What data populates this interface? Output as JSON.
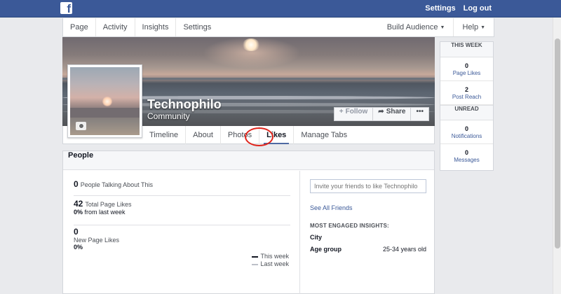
{
  "topbar": {
    "logo": "f",
    "links": [
      "Settings",
      "Log out"
    ]
  },
  "pagenav": {
    "left": [
      "Page",
      "Activity",
      "Insights",
      "Settings"
    ],
    "right": [
      "Build Audience",
      "Help"
    ]
  },
  "cover": {
    "title": "Technophilo",
    "subtitle": "Community",
    "buttons": {
      "follow": "Follow",
      "share": "Share",
      "more": "•••"
    }
  },
  "tabs": [
    "Timeline",
    "About",
    "Photos",
    "Likes",
    "Manage Tabs"
  ],
  "people": {
    "heading": "People",
    "talking": {
      "value": "0",
      "label": "People Talking About This"
    },
    "total_likes": {
      "value": "42",
      "label": "Total Page Likes",
      "change": "0%",
      "change_label": "from last week"
    },
    "new_likes": {
      "value": "0",
      "label": "New Page Likes",
      "change": "0%"
    },
    "legend": {
      "this_week": "This week",
      "last_week": "Last week"
    },
    "invite_placeholder": "Invite your friends to like Technophilo",
    "see_all": "See All Friends",
    "engaged_heading": "MOST ENGAGED INSIGHTS:",
    "city_label": "City",
    "age_label": "Age group",
    "age_value": "25-34 years old"
  },
  "sidebar": {
    "this_week": "THIS WEEK",
    "page_likes": {
      "value": "0",
      "label": "Page Likes"
    },
    "post_reach": {
      "value": "2",
      "label": "Post Reach"
    },
    "unread": "UNREAD",
    "notifications": {
      "value": "0",
      "label": "Notifications"
    },
    "messages": {
      "value": "0",
      "label": "Messages"
    }
  },
  "colors": {
    "brand_blue": "#3b5998",
    "highlight_red": "#e0241b",
    "this_week_line": "#141823",
    "last_week_line": "#bcc0c8"
  }
}
